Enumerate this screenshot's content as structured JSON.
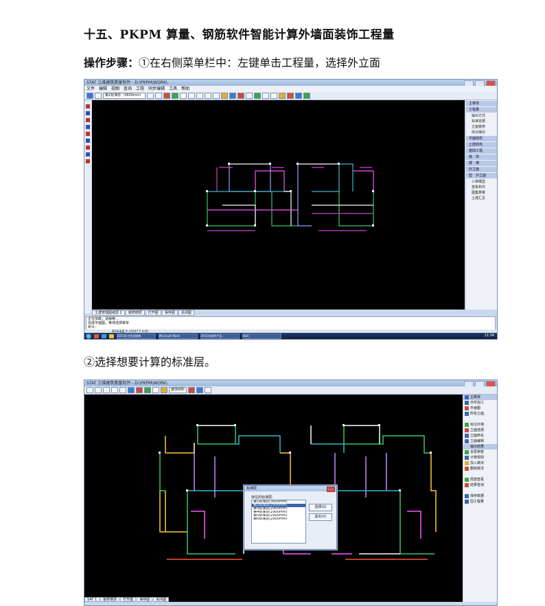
{
  "doc": {
    "title": "十五、PKPM 算量、钢筋软件智能计算外墙面装饰工程量",
    "step1_label": "操作步骤：",
    "step1_text": "①在右侧菜单栏中：左键单击工程量，选择外立面",
    "step2_text": "②选择想要计算的标准层。"
  },
  "shot1": {
    "window_title": "STAT 三维建筑算量软件 - D:\\PKPM\\WORK\\",
    "menu": [
      "文件",
      "编辑",
      "视图",
      "查询",
      "工程",
      "同步编辑",
      "工具",
      "帮助"
    ],
    "toolbar_select": "第1标准层（3600mm）",
    "right_panel": [
      {
        "label": "主菜单",
        "header": true
      },
      {
        "label": "工程量",
        "header": true
      },
      {
        "label": "输出方式",
        "header": false
      },
      {
        "label": "标准定额",
        "header": false
      },
      {
        "label": "立面装修",
        "header": false
      },
      {
        "label": "综合输出",
        "header": false
      },
      {
        "label": "平面结构",
        "header": true
      },
      {
        "label": "土建结构",
        "header": true
      },
      {
        "label": "基础工程",
        "header": true
      },
      {
        "label": "装　饰",
        "header": true
      },
      {
        "label": "楼　梯",
        "header": true
      },
      {
        "label": "外立面",
        "header": true
      },
      {
        "label": "型　外立面",
        "header": true
      },
      {
        "label": "三维模型",
        "header": false
      },
      {
        "label": "查看构件",
        "header": false
      },
      {
        "label": "图集算量",
        "header": false
      },
      {
        "label": "土建汇总",
        "header": false
      }
    ],
    "tabs": [
      "土建管理图纸层 2",
      "装修楼层",
      "打开图",
      "保存图",
      "关闭图"
    ],
    "command_lines": [
      "正在加载，请稍等...",
      "完成平面图，等待选择菜单",
      "命令："
    ],
    "status": "第1标准层 X: 25107 Y: 0.00",
    "taskbar_items": [
      "2011年工作总结单",
      "Microsoft Word",
      "2011年软件产品...",
      "Stat"
    ],
    "tray_time": "11:34"
  },
  "shot2": {
    "window_title": "STAT 三维建筑算量软件 - D:\\PKPM\\WORK\\",
    "toolbar_select": "装饰材料",
    "right_panel": [
      {
        "label": "主菜单",
        "header": true
      },
      {
        "label": "外形加工",
        "header": false
      },
      {
        "label": "平面图",
        "header": false
      },
      {
        "label": "所有立面",
        "header": false
      },
      {
        "label": "",
        "header": false
      },
      {
        "label": "标注外墙",
        "header": false
      },
      {
        "label": "立面选择",
        "header": false
      },
      {
        "label": "立面命名",
        "header": false
      },
      {
        "label": "立面编辑",
        "header": false
      },
      {
        "label": "输出结果",
        "header": true
      },
      {
        "label": "本层参数",
        "header": false
      },
      {
        "label": "计算规则",
        "header": false
      },
      {
        "label": "加入做法",
        "header": false
      },
      {
        "label": "删除做法",
        "header": false
      },
      {
        "label": "",
        "header": false
      },
      {
        "label": "局部查看",
        "header": false
      },
      {
        "label": "结果查询",
        "header": false
      },
      {
        "label": "",
        "header": false
      },
      {
        "label": "保存数据",
        "header": false
      },
      {
        "label": "回工程量",
        "header": false
      }
    ],
    "tabs": [
      "SAT 1",
      "装修楼层",
      "打开图",
      "保存图",
      "关闭图"
    ],
    "dialog": {
      "title": "标准层",
      "label": "存在的标准层:",
      "rows": [
        "第1标准层(3600mm)",
        "第2标准层(2900mm)",
        "第3标准层(2900mm)",
        "第4标准层(2900mm)",
        "第5标准层(2900mm)",
        "第6标准层(2900mm)"
      ],
      "selected_index": 1,
      "ok_label": "选择(S)",
      "cancel_label": "退出(X)"
    }
  }
}
